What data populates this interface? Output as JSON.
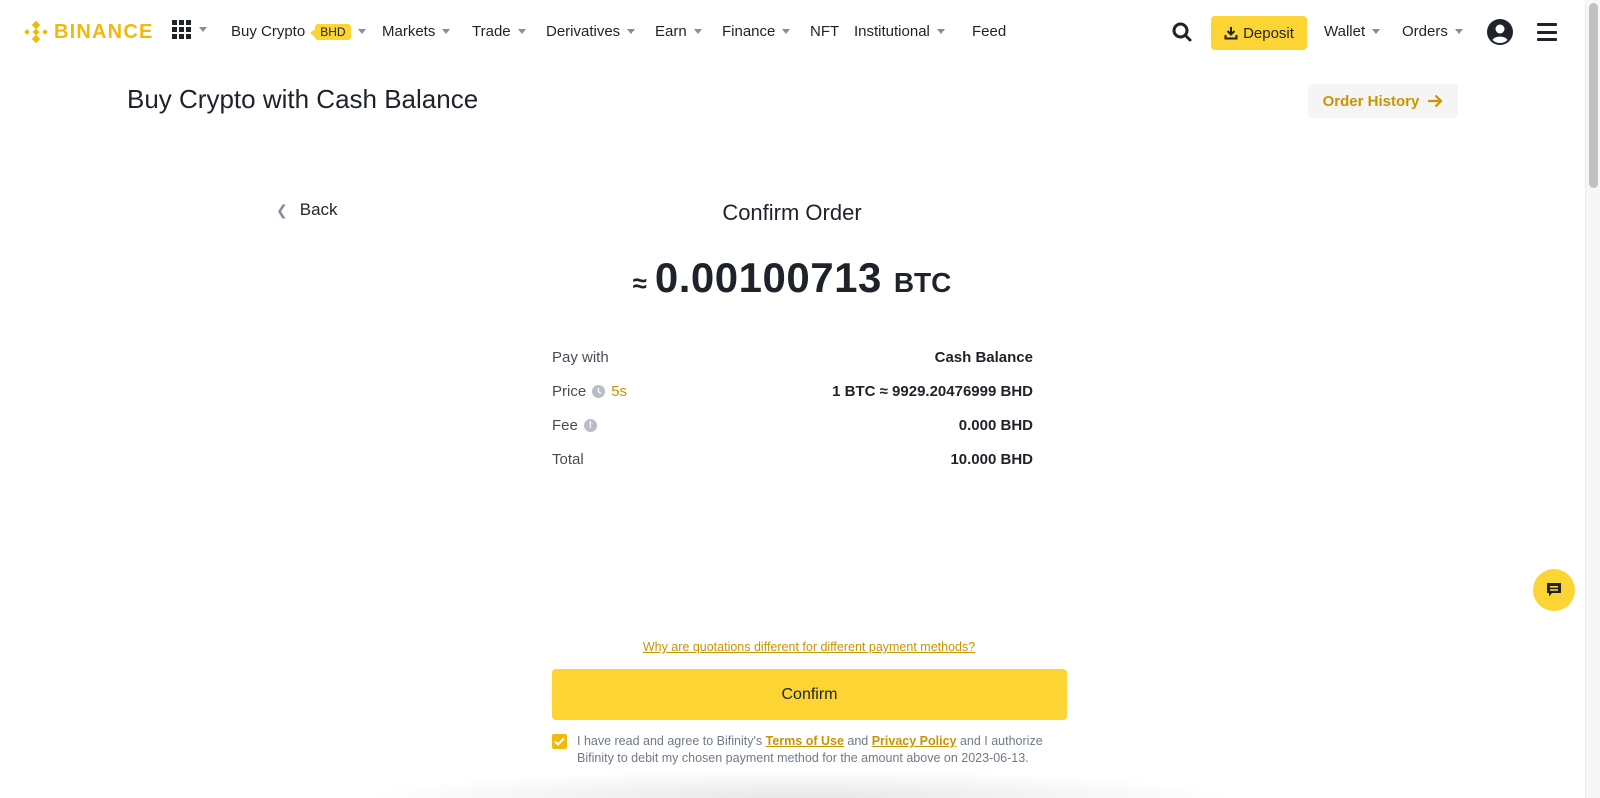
{
  "header": {
    "brand": "BINANCE",
    "nav": [
      {
        "label": "Buy Crypto",
        "badge": "BHD",
        "dropdown": true
      },
      {
        "label": "Markets",
        "dropdown": true
      },
      {
        "label": "Trade",
        "dropdown": true
      },
      {
        "label": "Derivatives",
        "dropdown": true
      },
      {
        "label": "Earn",
        "dropdown": true
      },
      {
        "label": "Finance",
        "dropdown": true
      },
      {
        "label": "NFT",
        "dropdown": false
      },
      {
        "label": "Institutional",
        "dropdown": true
      },
      {
        "label": "Feed",
        "dropdown": false
      }
    ],
    "deposit_label": "Deposit",
    "wallet_label": "Wallet",
    "orders_label": "Orders",
    "icons": [
      "apps-grid-icon",
      "search-icon",
      "download-icon",
      "profile-icon",
      "menu-icon"
    ]
  },
  "page": {
    "title": "Buy Crypto with Cash Balance",
    "order_history_label": "Order History"
  },
  "order": {
    "back_label": "Back",
    "title": "Confirm Order",
    "approx_symbol": "≈",
    "amount": "0.00100713",
    "unit": "BTC",
    "rows": [
      {
        "label": "Pay with",
        "value": "Cash Balance"
      },
      {
        "label": "Price",
        "countdown": "5s",
        "value": "1 BTC ≈ 9929.20476999 BHD"
      },
      {
        "label": "Fee",
        "value": "0.000 BHD"
      },
      {
        "label": "Total",
        "value": "10.000 BHD"
      }
    ],
    "quote_link": "Why are quotations different for different payment methods?",
    "confirm_label": "Confirm",
    "agreement": {
      "checked": true,
      "prefix": "I have read and agree to Bifinity's ",
      "terms_link": "Terms of Use",
      "middle": " and ",
      "privacy_link": "Privacy Policy",
      "suffix": " and I authorize Bifinity to debit my chosen payment method for the amount above on 2023-06-13."
    }
  },
  "colors": {
    "brand_yellow": "#fcd535",
    "brand_gold": "#f0b90b",
    "link_gold": "#c99400",
    "text_primary": "#1e2329"
  }
}
